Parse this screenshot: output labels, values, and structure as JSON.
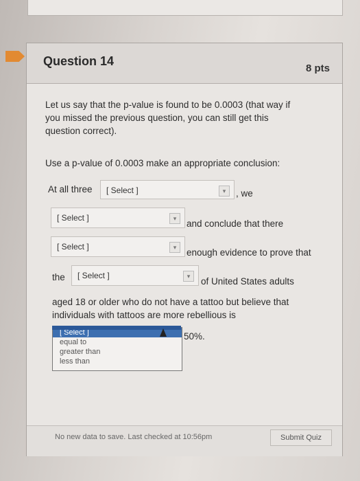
{
  "question": {
    "title": "Question 14",
    "points": "8 pts",
    "intro_line1": "Let us say that the p-value is found to be 0.0003 (that way if",
    "intro_line2": "you missed the previous question, you can still get this",
    "intro_line3": "question correct).",
    "instruction": "Use a p-value of 0.0003 make an appropriate conclusion:"
  },
  "sentence": {
    "at_all_three": "At all three",
    "we": ", we",
    "and_conclude": "and conclude that there",
    "enough_evidence": "enough evidence to prove that",
    "the": "the",
    "of_us_adults": "of United States adults",
    "aged_line1": "aged 18 or older who do not have a tattoo but believe that",
    "aged_line2": "individuals with tattoos are more rebellious is",
    "percent": "50%."
  },
  "selects": {
    "s1": "[ Select ]",
    "s2": "[ Select ]",
    "s3": "[ Select ]",
    "s4": "[ Select ]"
  },
  "dropdown": {
    "options": [
      "[ Select ]",
      "equal to",
      "greater than",
      "less than"
    ]
  },
  "footer": {
    "status": "No new data to save. Last checked at 10:56pm",
    "submit": "Submit Quiz"
  }
}
